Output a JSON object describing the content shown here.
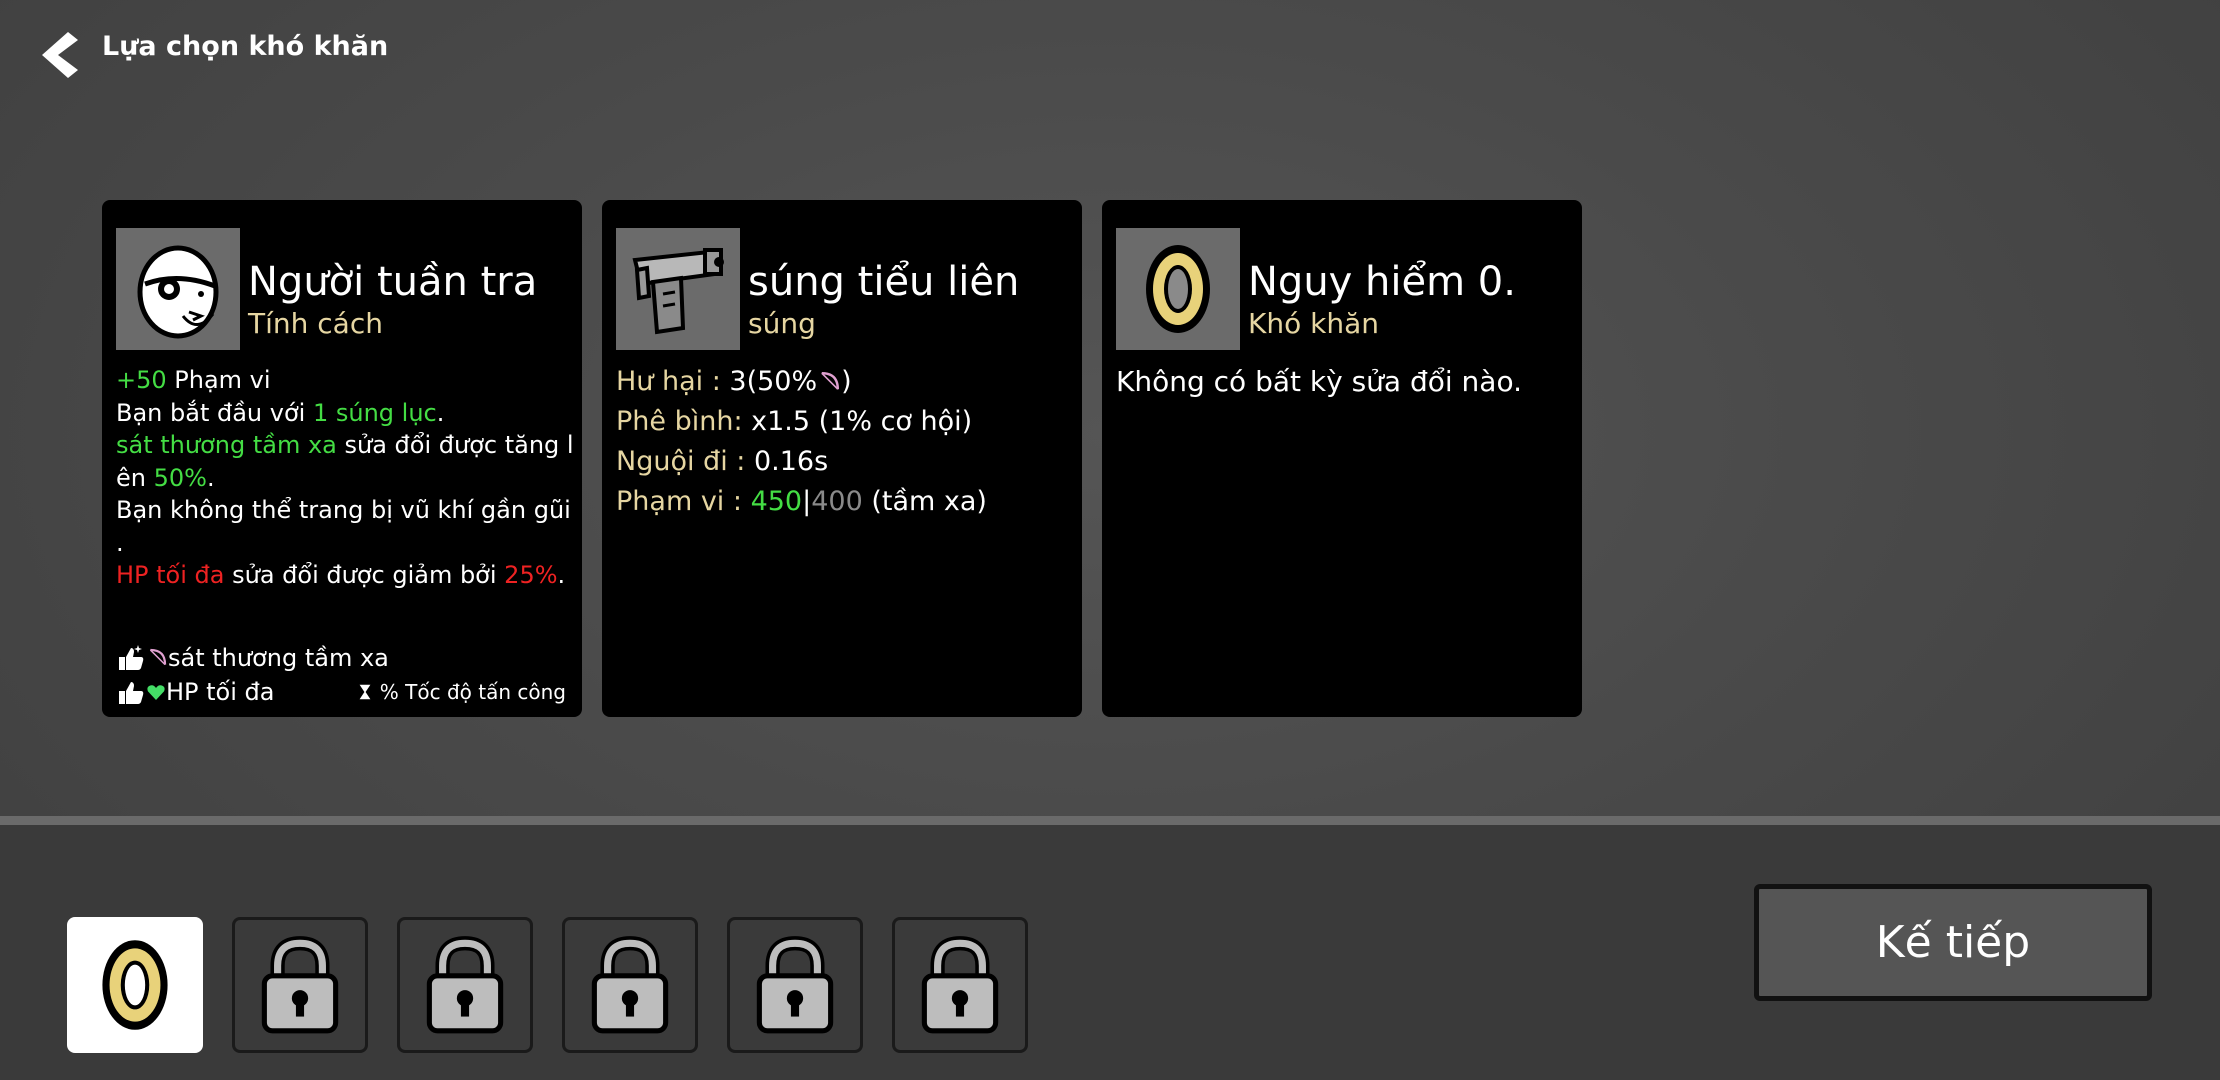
{
  "header": {
    "title": "Lựa chọn khó khăn"
  },
  "cards": {
    "character": {
      "name": "Người tuần tra",
      "type": "Tính cách",
      "lines": [
        {
          "a": "+50",
          "b": " Phạm vi"
        },
        {
          "a": "Bạn bắt đầu với ",
          "b": "1 súng lục",
          "c": "."
        },
        {
          "a": "sát thương tầm xa",
          "b": " sửa đổi được tăng l"
        },
        {
          "a": "ên ",
          "b": "50%",
          "c": "."
        },
        {
          "a": "Bạn không thể trang bị vũ khí gần gũi"
        },
        {
          "a": "."
        },
        {
          "a": "HP tối đa",
          "b": " sửa đổi được giảm bởi ",
          "c": "25%",
          "d": "."
        }
      ],
      "tags": {
        "t1": "sát thương tầm xa",
        "t2": "HP tối đa",
        "t3": "% Tốc độ tấn công"
      }
    },
    "weapon": {
      "name": "súng tiểu liên",
      "type": "súng",
      "damage_label": "Hư hại : ",
      "damage_value": "3(50%",
      "damage_close": ")",
      "crit_label": "Phê bình: ",
      "crit_value": "x1.5 (1% cơ hội)",
      "cooldown_label": "Nguội đi : ",
      "cooldown_value": "0.16s",
      "range_label": "Phạm vi : ",
      "range_value": "450",
      "range_sep": "|",
      "range_base": "400",
      "range_type": " (tầm xa)"
    },
    "difficulty": {
      "name": "Nguy hiểm 0.",
      "type": "Khó khăn",
      "description": "Không có bất kỳ sửa đổi nào."
    }
  },
  "next_button": "Kế tiếp",
  "slots": [
    {
      "state": "selected",
      "icon": "danger-0-ring-icon"
    },
    {
      "state": "locked",
      "icon": "padlock-icon"
    },
    {
      "state": "locked",
      "icon": "padlock-icon"
    },
    {
      "state": "locked",
      "icon": "padlock-icon"
    },
    {
      "state": "locked",
      "icon": "padlock-icon"
    },
    {
      "state": "locked",
      "icon": "padlock-icon"
    }
  ],
  "colors": {
    "positive": "#44dd44",
    "negative": "#ee2222",
    "subtitle": "#e6d6a2",
    "panel": "#000000"
  }
}
